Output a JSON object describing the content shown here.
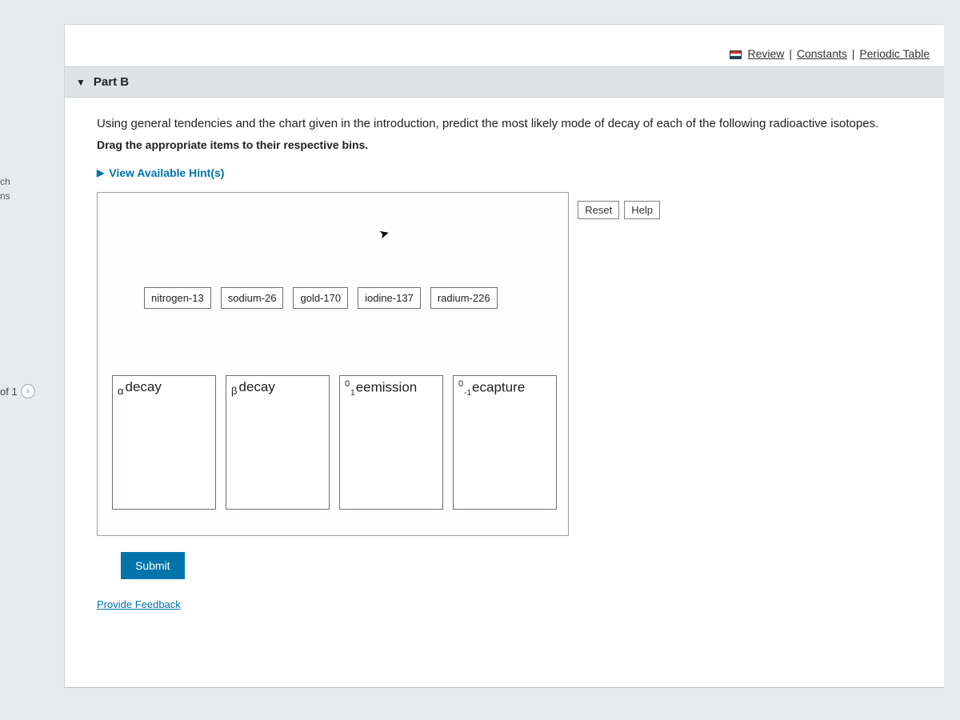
{
  "sidebar": {
    "snip1": "ch",
    "snip2": "ns",
    "pager_label": "of 1"
  },
  "top_links": {
    "review": "Review",
    "constants": "Constants",
    "periodic_table": "Periodic Table",
    "sep": "|"
  },
  "part": {
    "title": "Part B"
  },
  "instructions": {
    "line1": "Using general tendencies and the chart given in the introduction, predict the most likely mode of decay of each of the following radioactive isotopes.",
    "line2": "Drag the appropriate items to their respective bins."
  },
  "hints": {
    "toggle_label": "View Available Hint(s)"
  },
  "workspace": {
    "reset_label": "Reset",
    "help_label": "Help",
    "items": [
      {
        "label": "nitrogen-13"
      },
      {
        "label": "sodium-26"
      },
      {
        "label": "gold-170"
      },
      {
        "label": "iodine-137"
      },
      {
        "label": "radium-226"
      }
    ],
    "bins": [
      {
        "prefix_greek": "α",
        "text": "decay"
      },
      {
        "prefix_greek": "β",
        "text": "decay"
      },
      {
        "sup": "0",
        "sub": "1",
        "sym": "e",
        "text": "emission"
      },
      {
        "sup": "0",
        "sub": "-1",
        "sym": "e",
        "text": "capture"
      }
    ]
  },
  "submit_label": "Submit",
  "feedback_label": "Provide Feedback"
}
